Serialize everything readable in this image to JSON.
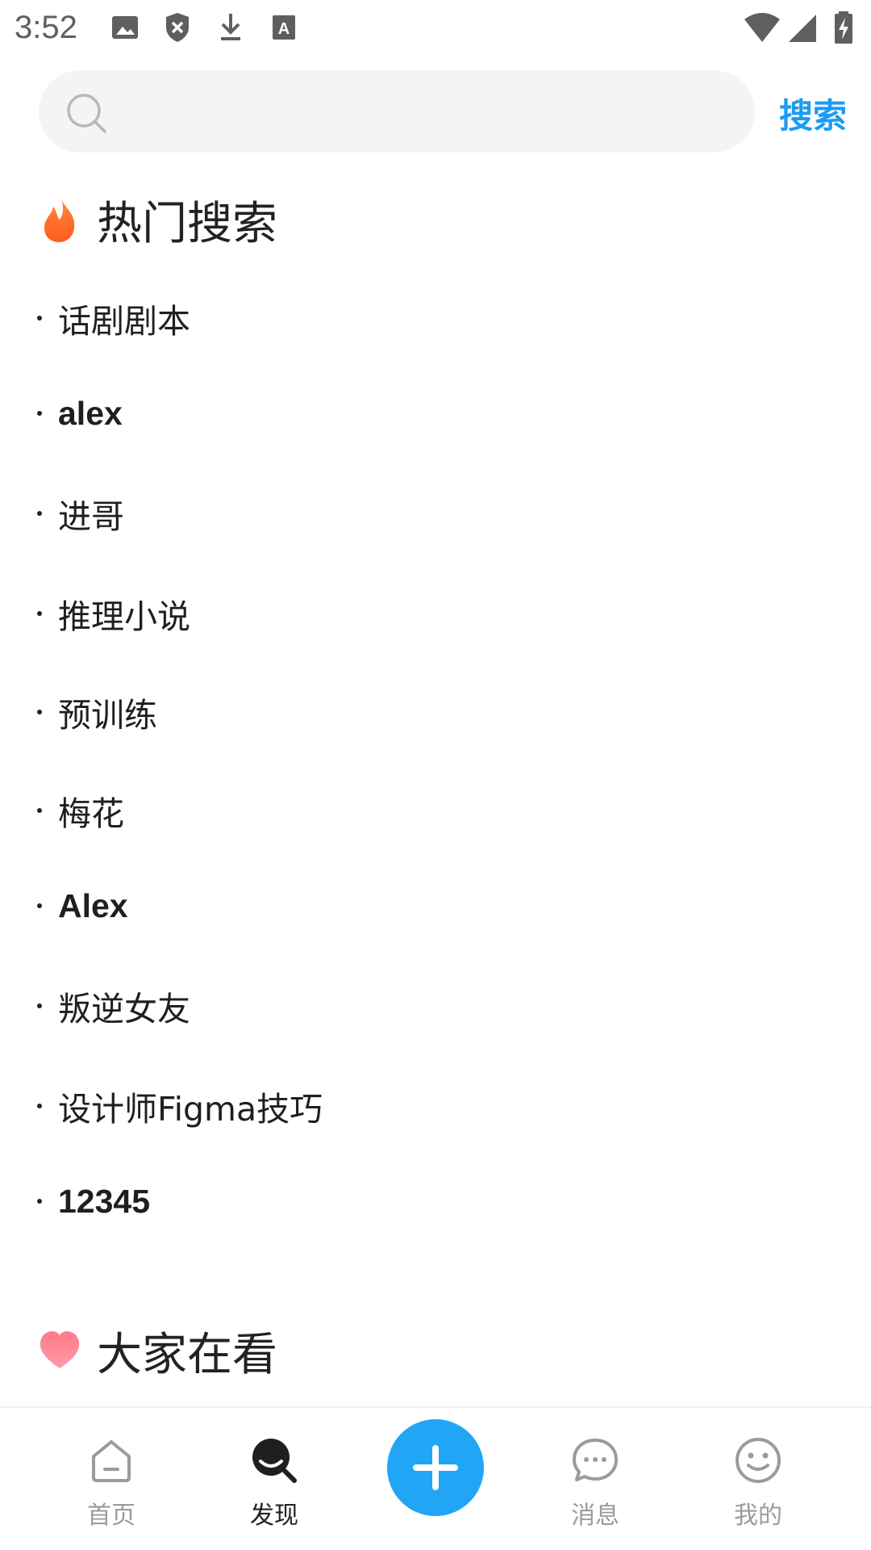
{
  "status_bar": {
    "time": "3:52",
    "icons": [
      "image-icon",
      "shield-icon",
      "download-icon",
      "text-icon",
      "wifi-icon",
      "signal-icon",
      "battery-charging-icon"
    ]
  },
  "search": {
    "placeholder": "",
    "value": "",
    "button_label": "搜索",
    "accent": "#1a9cf5"
  },
  "hot_search": {
    "title": "热门搜索",
    "icon": "flame-icon",
    "items": [
      "话剧剧本",
      "alex",
      "进哥",
      "推理小说",
      "预训练",
      "梅花",
      "Alex",
      "叛逆女友",
      "设计师Figma技巧",
      "12345"
    ]
  },
  "watching": {
    "title": "大家在看",
    "icon": "heart-icon"
  },
  "bottom_nav": {
    "items": [
      {
        "label": "首页",
        "icon": "home-icon",
        "active": false
      },
      {
        "label": "发现",
        "icon": "discover-icon",
        "active": true
      },
      {
        "label": "消息",
        "icon": "message-icon",
        "active": false
      },
      {
        "label": "我的",
        "icon": "smile-icon",
        "active": false
      }
    ],
    "fab_icon": "plus-icon",
    "fab_color": "#21a6f5"
  }
}
